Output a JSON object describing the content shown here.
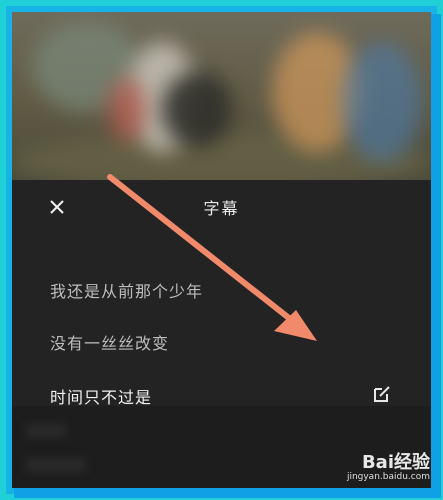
{
  "subtitle_panel": {
    "title": "字幕",
    "lines": [
      "我还是从前那个少年",
      "没有一丝丝改变",
      "时间只不过是"
    ]
  },
  "icons": {
    "close": "close-icon",
    "edit": "edit-icon",
    "annotation": "arrow-annotation"
  },
  "watermark": {
    "brand": "Bai经验",
    "url": "jingyan.baidu.com"
  },
  "colors": {
    "frame": "#1fd0d6",
    "panel_bg": "#232323",
    "annotation_arrow": "#f08a6a"
  }
}
